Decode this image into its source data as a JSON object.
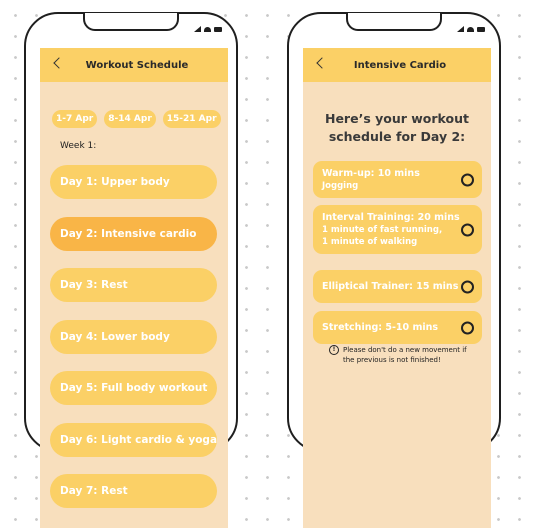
{
  "schedule_screen": {
    "title": "Workout Schedule",
    "week_chips": [
      "1-7 Apr",
      "8-14 Apr",
      "15-21 Apr"
    ],
    "week_label": "Week 1:",
    "days": [
      "Day 1: Upper body",
      "Day 2: Intensive cardio",
      "Day 3: Rest",
      "Day 4: Lower body",
      "Day 5: Full body workout",
      "Day 6: Light cardio & yoga",
      "Day 7: Rest"
    ],
    "active_day_index": 1
  },
  "detail_screen": {
    "title": "Intensive Cardio",
    "heading_line1": "Here’s your workout",
    "heading_line2": "schedule for Day 2:",
    "cards": [
      {
        "title": "Warm-up: 10 mins",
        "sub": [
          "Jogging"
        ]
      },
      {
        "title": "Interval Training: 20 mins",
        "sub": [
          "1 minute of fast running,",
          "1 minute of walking"
        ]
      },
      {
        "title": "Elliptical Trainer: 15 mins",
        "sub": []
      },
      {
        "title": "Stretching: 5-10 mins",
        "sub": []
      }
    ],
    "note_line1": "Please don't do a new movement if",
    "note_line2": "the previous is not finished!"
  },
  "colors": {
    "header_bg": "#fbd066",
    "screen_bg": "#f8dfbd",
    "active_day": "#f9b547"
  }
}
